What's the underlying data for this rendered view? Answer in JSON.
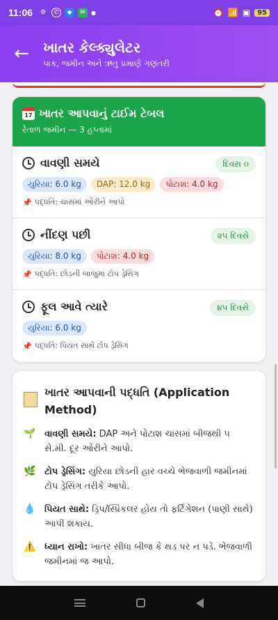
{
  "status": {
    "time": "11:06",
    "battery": "95"
  },
  "appbar": {
    "title": "ખાતર કેલ્ક્યુલેટર",
    "subtitle": "પાક, જમીન અને ઋતુ પ્રમાણે ગણતરી"
  },
  "timetable": {
    "title": "ખાતર આપવાનું ટાઈમ ટેબલ",
    "subtitle": "રેતાળ જમીન — 3 હપ્તામાં",
    "stages": [
      {
        "title": "વાવણી સમયે",
        "badge": "દિવસ ૦",
        "pills": [
          {
            "type": "u",
            "label": "યુરિયા: 6.0 kg"
          },
          {
            "type": "d",
            "label": "DAP: 12.0 kg"
          },
          {
            "type": "p",
            "label": "પોટાશ: 4.0 kg"
          }
        ],
        "method": "પદ્ધતિ: ચાસમાં ઓરીને આપો"
      },
      {
        "title": "નીંદણ પછી",
        "badge": "૨૫ દિવસે",
        "pills": [
          {
            "type": "u",
            "label": "યુરિયા: 8.0 kg"
          },
          {
            "type": "p",
            "label": "પોટાશ: 4.0 kg"
          }
        ],
        "method": "પદ્ધતિ: છોડની બાજુમાં ટોપ ડ્રેસિંગ"
      },
      {
        "title": "ફૂલ આવે ત્યારે",
        "badge": "૪૫ દિવસે",
        "pills": [
          {
            "type": "u",
            "label": "યુરિયા: 6.0 kg"
          }
        ],
        "method": "પદ્ધતિ: પિયત સાથે ટોપ ડ્રેસિંગ"
      }
    ]
  },
  "application": {
    "title": "ખાતર આપવાની પદ્ધતિ (Application Method)",
    "rows": [
      {
        "icon": "seedling-icon",
        "glyph": "🌱",
        "label": "વાવણી સમયે:",
        "text": "DAP અને પોટાશ ચાસમાં બીજથી ૫ સે.મી. દૂર ઓરીને આપો."
      },
      {
        "icon": "leaf-icon",
        "glyph": "🌿",
        "label": "ટોપ ડ્રેસિંગ:",
        "text": "યુરિયા છોડની હાર વચ્ચે ભેજવાળી જમીનમાં ટોપ ડ્રેસિંગ તરીકે આપો."
      },
      {
        "icon": "water-drop-icon",
        "glyph": "💧",
        "label": "પિયત સાથે:",
        "text": "ડ્રિપ/સ્પ્રિંકલર હોય તો ફર્ટિગેશન (પાણી સાથે) આપી શકાય."
      },
      {
        "icon": "warning-icon",
        "glyph": "⚠️",
        "label": "ધ્યાન રાખો:",
        "text": "ખાતર સીધા બીજ કે થડ પર ન પડે. ભેજવાળી જમીનમાં જ આપો."
      }
    ]
  },
  "colors": {
    "accent": "#8a3ff0",
    "green": "#1ba44a",
    "danger": "#d93535"
  }
}
